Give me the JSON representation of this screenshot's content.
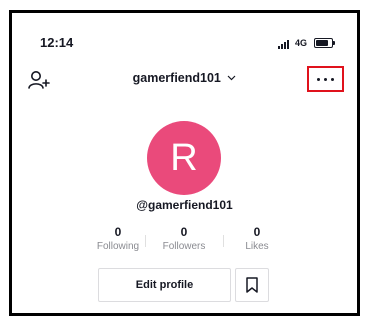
{
  "status_bar": {
    "time": "12:14",
    "network": "4G",
    "signal_icon": "signal-icon",
    "battery_icon": "battery-icon"
  },
  "header": {
    "username": "gamerfiend101",
    "add_friend_icon": "add-user-icon",
    "chevron_icon": "chevron-down-icon",
    "more_icon": "more-dots-icon",
    "highlight_color": "#e0121c"
  },
  "profile": {
    "avatar_letter": "R",
    "avatar_color": "#ea4a7b",
    "handle": "@gamerfiend101",
    "stats": [
      {
        "value": "0",
        "label": "Following"
      },
      {
        "value": "0",
        "label": "Followers"
      },
      {
        "value": "0",
        "label": "Likes"
      }
    ],
    "edit_label": "Edit profile",
    "bookmark_icon": "bookmark-icon"
  }
}
